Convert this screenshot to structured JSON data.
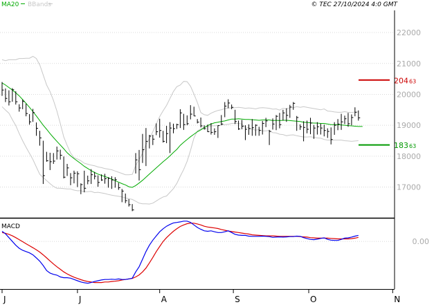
{
  "header": {
    "ma_label": "MA20",
    "bb_label": "BBands",
    "copyright": "© TEC 27/10/2024 4:0 GMT"
  },
  "colors": {
    "candles": "#000000",
    "ma20": "#00aa00",
    "bbands": "#c8c8c8",
    "resistance": "#cc0000",
    "support": "#009900",
    "macd_line": "#0000ee",
    "signal_line": "#dd0000",
    "grid": "#d8d8d8",
    "axis_text": "#aaaaaa"
  },
  "chart_data": [
    {
      "type": "candlestick",
      "name": "price",
      "ylim": [
        16050,
        22650
      ],
      "yticks": [
        "22000",
        "21000",
        "20000",
        "19000",
        "18000",
        "17000"
      ],
      "ytick_values": [
        22000,
        21000,
        20000,
        19000,
        18000,
        17000
      ],
      "legend": [
        "MA20",
        "BBands"
      ],
      "levels": [
        {
          "value": 20463,
          "label": "204",
          "label_sup": "63",
          "color": "#cc0000"
        },
        {
          "value": 18363,
          "label": "183",
          "label_sup": "63",
          "color": "#009900"
        }
      ],
      "bars_hlc": [
        [
          20400,
          19950,
          20140
        ],
        [
          20190,
          19750,
          19870
        ],
        [
          20130,
          19640,
          19760
        ],
        [
          20200,
          19760,
          20150
        ],
        [
          20100,
          19670,
          19760
        ],
        [
          19680,
          19440,
          19560
        ],
        [
          19830,
          19520,
          19770
        ],
        [
          19700,
          19290,
          19380
        ],
        [
          19360,
          19020,
          19110
        ],
        [
          19530,
          19110,
          19410
        ],
        [
          19090,
          18660,
          18900
        ],
        [
          18820,
          18340,
          18590
        ],
        [
          18500,
          17100,
          17370
        ],
        [
          18140,
          17820,
          17850
        ],
        [
          18110,
          17550,
          17820
        ],
        [
          18100,
          17750,
          17840
        ],
        [
          18310,
          17890,
          18170
        ],
        [
          18210,
          17890,
          18030
        ],
        [
          17990,
          17280,
          17320
        ],
        [
          17750,
          17360,
          17620
        ],
        [
          17450,
          17060,
          17300
        ],
        [
          17530,
          17120,
          17450
        ],
        [
          17510,
          17000,
          17430
        ],
        [
          17120,
          16770,
          17080
        ],
        [
          17530,
          16830,
          16960
        ],
        [
          17370,
          17090,
          17200
        ],
        [
          17580,
          17100,
          17400
        ],
        [
          17490,
          17250,
          17350
        ],
        [
          17380,
          17010,
          17150
        ],
        [
          17410,
          17200,
          17230
        ],
        [
          17430,
          17110,
          17270
        ],
        [
          17320,
          16980,
          17280
        ],
        [
          17350,
          16940,
          17230
        ],
        [
          17320,
          16980,
          17240
        ],
        [
          17140,
          16910,
          16980
        ],
        [
          16940,
          16510,
          16870
        ],
        [
          16790,
          16480,
          16560
        ],
        [
          16610,
          16370,
          16430
        ],
        [
          16450,
          16220,
          16260
        ],
        [
          18100,
          17440,
          17880
        ],
        [
          18200,
          17210,
          17560
        ],
        [
          18720,
          17780,
          18210
        ],
        [
          18910,
          17680,
          18480
        ],
        [
          18690,
          18250,
          18650
        ],
        [
          18690,
          18360,
          18550
        ],
        [
          19060,
          18680,
          18790
        ],
        [
          19210,
          18600,
          18830
        ],
        [
          18820,
          18440,
          18480
        ],
        [
          18980,
          18420,
          18730
        ],
        [
          19100,
          18100,
          18910
        ],
        [
          19050,
          18740,
          18890
        ],
        [
          19050,
          18880,
          19020
        ],
        [
          19520,
          18910,
          19400
        ],
        [
          19370,
          18850,
          19020
        ],
        [
          19320,
          19000,
          19050
        ],
        [
          19650,
          19190,
          19360
        ],
        [
          19600,
          19300,
          19300
        ],
        [
          19200,
          19060,
          19100
        ],
        [
          19250,
          18930,
          18980
        ],
        [
          19000,
          18860,
          18890
        ],
        [
          19020,
          18780,
          18790
        ],
        [
          19070,
          18700,
          18770
        ],
        [
          18900,
          18690,
          18790
        ],
        [
          19000,
          18590,
          18990
        ],
        [
          19330,
          19000,
          19040
        ],
        [
          19750,
          19260,
          19620
        ],
        [
          19840,
          19550,
          19720
        ],
        [
          19670,
          19520,
          19580
        ],
        [
          19500,
          19040,
          19120
        ],
        [
          19150,
          18850,
          18880
        ],
        [
          19170,
          18870,
          18970
        ],
        [
          19000,
          18520,
          18870
        ],
        [
          19030,
          18690,
          18890
        ],
        [
          19200,
          18660,
          18920
        ],
        [
          19030,
          18660,
          19000
        ],
        [
          18950,
          18660,
          18830
        ],
        [
          19140,
          18700,
          19060
        ],
        [
          19240,
          18940,
          19140
        ],
        [
          18850,
          18360,
          18800
        ],
        [
          19220,
          18860,
          19040
        ],
        [
          19330,
          18840,
          19290
        ],
        [
          19400,
          18900,
          19020
        ],
        [
          19500,
          19150,
          19400
        ],
        [
          19550,
          19110,
          19320
        ],
        [
          19660,
          19240,
          19590
        ],
        [
          19750,
          19500,
          19710
        ],
        [
          19300,
          18820,
          19250
        ],
        [
          19030,
          18850,
          18950
        ],
        [
          19130,
          18480,
          18930
        ],
        [
          19150,
          18740,
          18870
        ],
        [
          19240,
          18710,
          19070
        ],
        [
          19010,
          18560,
          18910
        ],
        [
          19100,
          18700,
          18950
        ],
        [
          19050,
          18700,
          18910
        ],
        [
          19020,
          18640,
          18830
        ],
        [
          18900,
          18590,
          18800
        ],
        [
          18930,
          18380,
          18540
        ],
        [
          19100,
          18690,
          19000
        ],
        [
          19200,
          18840,
          19040
        ],
        [
          19370,
          18850,
          19110
        ],
        [
          19310,
          19040,
          19210
        ],
        [
          19400,
          18950,
          19050
        ],
        [
          19350,
          19000,
          19250
        ],
        [
          19580,
          19290,
          19420
        ],
        [
          19480,
          19150,
          19240
        ]
      ],
      "ma20": [
        20370,
        20300,
        20220,
        20140,
        20050,
        19950,
        19830,
        19710,
        19580,
        19440,
        19300,
        19150,
        19000,
        18870,
        18730,
        18600,
        18480,
        18360,
        18240,
        18110,
        18010,
        17920,
        17840,
        17760,
        17670,
        17600,
        17530,
        17470,
        17420,
        17380,
        17340,
        17300,
        17260,
        17210,
        17160,
        17110,
        17070,
        17010,
        16990,
        17050,
        17130,
        17220,
        17320,
        17420,
        17520,
        17620,
        17720,
        17820,
        17910,
        18010,
        18120,
        18220,
        18350,
        18450,
        18540,
        18630,
        18710,
        18790,
        18850,
        18920,
        18990,
        19040,
        19080,
        19100,
        19120,
        19140,
        19170,
        19200,
        19200,
        19210,
        19200,
        19190,
        19190,
        19180,
        19170,
        19160,
        19170,
        19170,
        19170,
        19150,
        19160,
        19150,
        19160,
        19160,
        19150,
        19140,
        19130,
        19120,
        19100,
        19090,
        19080,
        19070,
        19070,
        19060,
        19060,
        19040,
        19020,
        19020,
        19020,
        19010,
        19000,
        18990,
        18980,
        18970,
        18960
      ],
      "bb_upper": [
        21120,
        21090,
        21120,
        21120,
        21120,
        21160,
        21160,
        21170,
        21170,
        21230,
        21160,
        20950,
        20630,
        20300,
        20090,
        19800,
        19460,
        19050,
        18620,
        18350,
        18100,
        17950,
        17910,
        17850,
        17770,
        17740,
        17710,
        17690,
        17650,
        17630,
        17600,
        17580,
        17560,
        17520,
        17480,
        17440,
        17400,
        17400,
        17410,
        17700,
        17890,
        18100,
        18380,
        18560,
        18790,
        19050,
        19280,
        19470,
        19640,
        19870,
        20090,
        20250,
        20300,
        20420,
        20410,
        20260,
        20010,
        19730,
        19410,
        19340,
        19320,
        19390,
        19440,
        19480,
        19500,
        19540,
        19560,
        19560,
        19570,
        19580,
        19570,
        19550,
        19560,
        19550,
        19530,
        19560,
        19570,
        19560,
        19550,
        19520,
        19530,
        19490,
        19550,
        19530,
        19570,
        19570,
        19600,
        19580,
        19600,
        19580,
        19560,
        19540,
        19520,
        19500,
        19530,
        19460,
        19450,
        19430,
        19420,
        19420,
        19440,
        19420,
        19410,
        19430,
        19430
      ],
      "bb_lower": [
        19600,
        19490,
        19390,
        19180,
        18990,
        18730,
        18500,
        18290,
        18090,
        17890,
        17650,
        17410,
        17310,
        17210,
        17110,
        17020,
        16960,
        16960,
        16950,
        16940,
        16940,
        16900,
        16880,
        16880,
        16850,
        16850,
        16860,
        16820,
        16830,
        16810,
        16790,
        16760,
        16740,
        16720,
        16700,
        16680,
        16650,
        16620,
        16600,
        16540,
        16480,
        16460,
        16460,
        16450,
        16480,
        16550,
        16620,
        16680,
        16710,
        16830,
        16950,
        17120,
        17350,
        17570,
        17830,
        18190,
        18590,
        18820,
        18880,
        18940,
        18960,
        18980,
        18980,
        18990,
        19010,
        19020,
        19030,
        19060,
        19060,
        19060,
        19040,
        18940,
        18920,
        18870,
        18840,
        18860,
        18820,
        18820,
        18830,
        18760,
        18750,
        18710,
        18700,
        18660,
        18680,
        18690,
        18660,
        18640,
        18620,
        18620,
        18630,
        18610,
        18590,
        18580,
        18540,
        18520,
        18520,
        18520,
        18520,
        18520,
        18500,
        18490,
        18480,
        18490,
        18500
      ]
    },
    {
      "type": "line",
      "name": "MACD",
      "title": "MACD",
      "ylim": [
        -185,
        85
      ],
      "yticks": [
        "0.00"
      ],
      "ytick_values": [
        0
      ],
      "series": [
        {
          "name": "MACD",
          "values": [
            40,
            30,
            15,
            0,
            -15,
            -27,
            -35,
            -40,
            -45,
            -53,
            -65,
            -78,
            -95,
            -115,
            -125,
            -130,
            -133,
            -140,
            -143,
            -143,
            -145,
            -150,
            -155,
            -160,
            -163,
            -165,
            -162,
            -158,
            -155,
            -152,
            -150,
            -150,
            -149,
            -150,
            -148,
            -150,
            -150,
            -148,
            -145,
            -120,
            -100,
            -70,
            -40,
            -15,
            5,
            22,
            38,
            50,
            60,
            67,
            73,
            75,
            77,
            80,
            80,
            75,
            65,
            55,
            48,
            42,
            40,
            42,
            38,
            35,
            35,
            38,
            42,
            35,
            28,
            25,
            24,
            24,
            21,
            20,
            20,
            20,
            21,
            20,
            19,
            16,
            17,
            18,
            17,
            18,
            19,
            19,
            21,
            20,
            15,
            11,
            8,
            7,
            9,
            12,
            14,
            8,
            5,
            4,
            4,
            8,
            13,
            14,
            17,
            21,
            24
          ]
        },
        {
          "name": "Signal",
          "values": [
            35,
            32,
            28,
            22,
            15,
            7,
            -1,
            -9,
            -17,
            -25,
            -33,
            -42,
            -53,
            -65,
            -77,
            -89,
            -100,
            -110,
            -120,
            -128,
            -135,
            -141,
            -146,
            -151,
            -155,
            -158,
            -160,
            -162,
            -162,
            -162,
            -160,
            -160,
            -158,
            -157,
            -155,
            -152,
            -150,
            -148,
            -146,
            -140,
            -132,
            -120,
            -105,
            -85,
            -63,
            -40,
            -20,
            0,
            15,
            28,
            40,
            50,
            59,
            65,
            70,
            72,
            72,
            69,
            65,
            60,
            57,
            55,
            53,
            51,
            47,
            44,
            41,
            39,
            37,
            35,
            33,
            31,
            29,
            26,
            25,
            24,
            23,
            22,
            22,
            22,
            21,
            20,
            20,
            20,
            20,
            20,
            20,
            19,
            18,
            17,
            15,
            14,
            13,
            13,
            13,
            13,
            12,
            11,
            10,
            10,
            10,
            10,
            11,
            13,
            16
          ]
        }
      ]
    }
  ],
  "xaxis": {
    "labels": [
      "J",
      "J",
      "A",
      "S",
      "O",
      "N"
    ],
    "positions": [
      0,
      22,
      46,
      67.5,
      89.5,
      114
    ]
  }
}
